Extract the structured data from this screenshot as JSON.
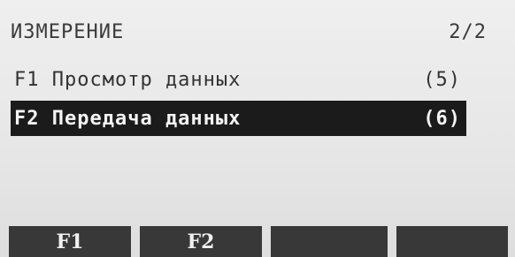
{
  "header": {
    "title": "ИЗМЕРЕНИЕ",
    "page": "2/2"
  },
  "menu": {
    "items": [
      {
        "label": "F1 Просмотр данных",
        "count": "(5)",
        "selected": false
      },
      {
        "label": "F2 Передача данных",
        "count": "(6)",
        "selected": true
      }
    ]
  },
  "softkeys": [
    {
      "label": "F1"
    },
    {
      "label": "F2"
    },
    {
      "label": ""
    },
    {
      "label": ""
    }
  ]
}
